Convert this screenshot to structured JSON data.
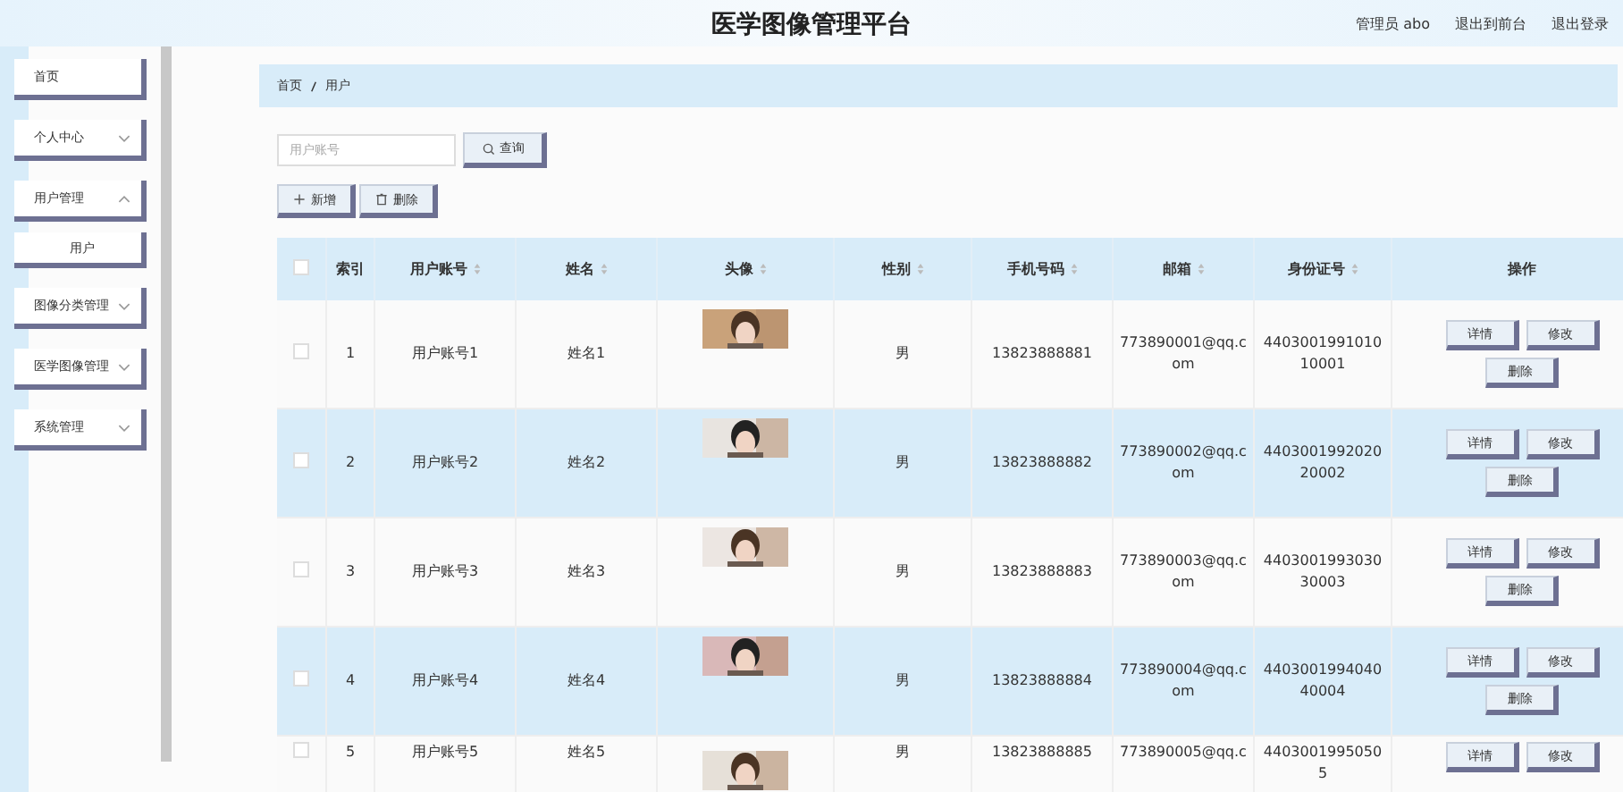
{
  "header": {
    "title": "医学图像管理平台",
    "links": [
      "管理员 abo",
      "退出到前台",
      "退出登录"
    ]
  },
  "sidebar": {
    "items": [
      {
        "label": "首页",
        "expandable": false,
        "expanded": false
      },
      {
        "label": "个人中心",
        "expandable": true,
        "expanded": false
      },
      {
        "label": "用户管理",
        "expandable": true,
        "expanded": true,
        "children": [
          {
            "label": "用户"
          }
        ]
      },
      {
        "label": "图像分类管理",
        "expandable": true,
        "expanded": false
      },
      {
        "label": "医学图像管理",
        "expandable": true,
        "expanded": false
      },
      {
        "label": "系统管理",
        "expandable": true,
        "expanded": false
      }
    ]
  },
  "breadcrumb": [
    "首页",
    "用户"
  ],
  "search": {
    "placeholder": "用户账号",
    "button": "查询"
  },
  "actions": [
    "新增",
    "删除"
  ],
  "table": {
    "columns": [
      "索引",
      "用户账号",
      "姓名",
      "头像",
      "性别",
      "手机号码",
      "邮箱",
      "身份证号",
      "操作"
    ],
    "all_checked": false,
    "rows": [
      {
        "index": "1",
        "account": "用户账号1",
        "name": "姓名1",
        "gender": "男",
        "phone": "13823888881",
        "email": "773890001@qq.com",
        "id_number": "440300199101010001",
        "checked": false,
        "buttons": [
          "详情",
          "修改",
          "删除"
        ]
      },
      {
        "index": "2",
        "account": "用户账号2",
        "name": "姓名2",
        "gender": "男",
        "phone": "13823888882",
        "email": "773890002@qq.com",
        "id_number": "440300199202020002",
        "checked": false,
        "buttons": [
          "详情",
          "修改",
          "删除"
        ]
      },
      {
        "index": "3",
        "account": "用户账号3",
        "name": "姓名3",
        "gender": "男",
        "phone": "13823888883",
        "email": "773890003@qq.com",
        "id_number": "440300199303030003",
        "checked": false,
        "buttons": [
          "详情",
          "修改",
          "删除"
        ]
      },
      {
        "index": "4",
        "account": "用户账号4",
        "name": "姓名4",
        "gender": "男",
        "phone": "13823888884",
        "email": "773890004@qq.com",
        "id_number": "440300199404040004",
        "checked": false,
        "buttons": [
          "详情",
          "修改",
          "删除"
        ]
      },
      {
        "index": "5",
        "account": "用户账号5",
        "name": "姓名5",
        "gender": "男",
        "phone": "13823888885",
        "email": "773890005@qq.c",
        "id_number": "44030019950505",
        "checked": false,
        "buttons": [
          "详情",
          "修改"
        ]
      }
    ]
  }
}
